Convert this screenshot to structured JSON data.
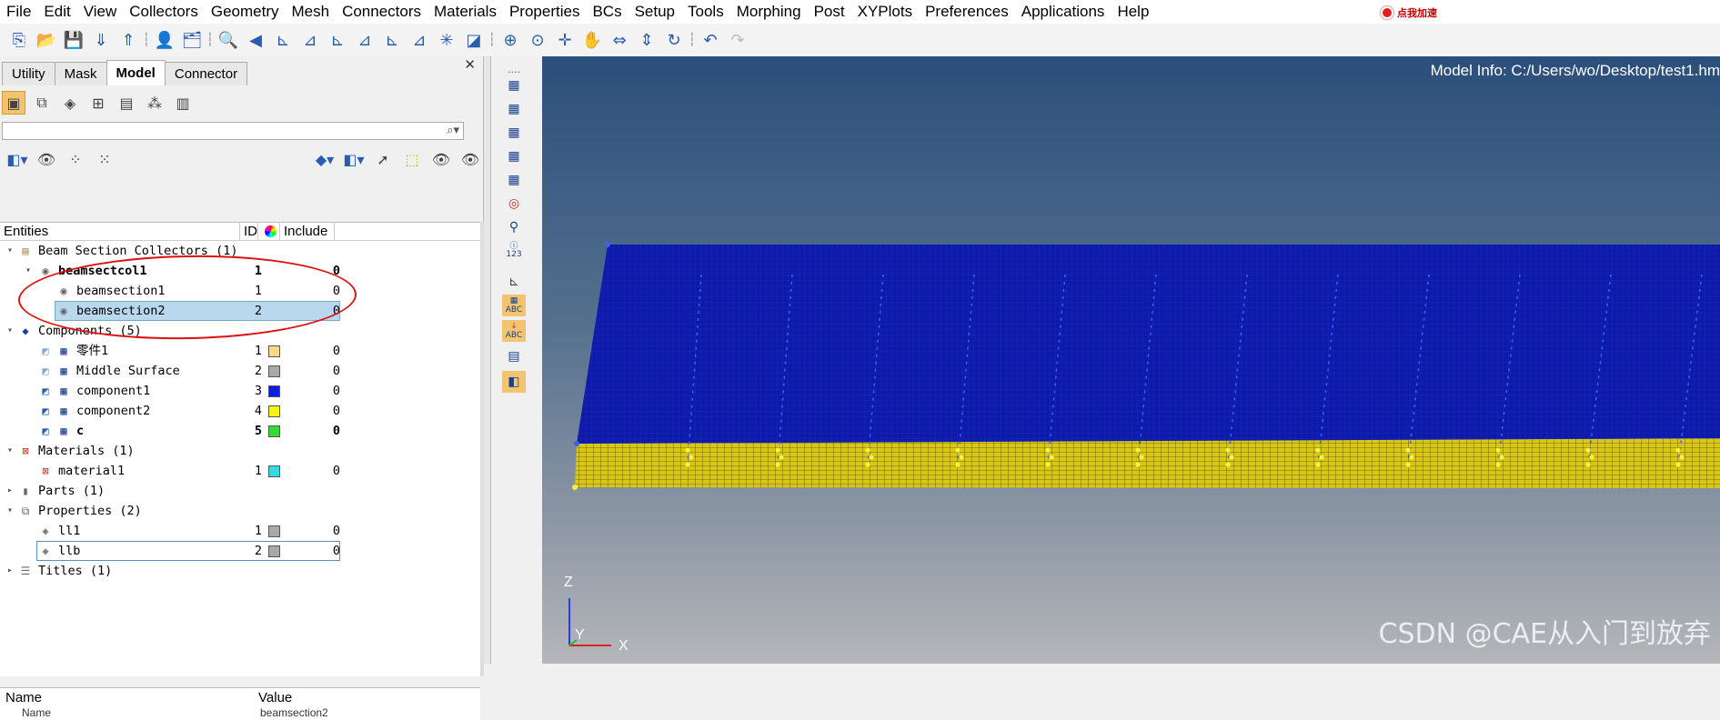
{
  "menu": [
    "File",
    "Edit",
    "View",
    "Collectors",
    "Geometry",
    "Mesh",
    "Connectors",
    "Materials",
    "Properties",
    "BCs",
    "Setup",
    "Tools",
    "Morphing",
    "Post",
    "XYPlots",
    "Preferences",
    "Applications",
    "Help"
  ],
  "accel_badge": "点我加速",
  "tabs": [
    "Utility",
    "Mask",
    "Model",
    "Connector"
  ],
  "active_tab": "Model",
  "browser": {
    "headers": {
      "entities": "Entities",
      "id": "ID",
      "include": "Include"
    },
    "rows": [
      {
        "name": "Beam Section Collectors (1)",
        "id": "",
        "include": ""
      },
      {
        "name": "beamsectcol1",
        "id": "1",
        "include": "0"
      },
      {
        "name": "beamsection1",
        "id": "1",
        "include": "0"
      },
      {
        "name": "beamsection2",
        "id": "2",
        "include": "0"
      },
      {
        "name": "Components (5)",
        "id": "",
        "include": ""
      },
      {
        "name": "零件1",
        "id": "1",
        "include": "0",
        "color": "#f6d98a"
      },
      {
        "name": "Middle Surface",
        "id": "2",
        "include": "0",
        "color": "#a8a8a8"
      },
      {
        "name": "component1",
        "id": "3",
        "include": "0",
        "color": "#1020d8"
      },
      {
        "name": "component2",
        "id": "4",
        "include": "0",
        "color": "#f4f414"
      },
      {
        "name": "c",
        "id": "5",
        "include": "0",
        "color": "#38d838"
      },
      {
        "name": "Materials (1)",
        "id": "",
        "include": ""
      },
      {
        "name": "material1",
        "id": "1",
        "include": "0",
        "color": "#38d8e0"
      },
      {
        "name": "Parts (1)",
        "id": "",
        "include": ""
      },
      {
        "name": "Properties (2)",
        "id": "",
        "include": ""
      },
      {
        "name": "ll1",
        "id": "1",
        "include": "0",
        "color": "#a8a8a8"
      },
      {
        "name": "llb",
        "id": "2",
        "include": "0",
        "color": "#a8a8a8"
      },
      {
        "name": "Titles (1)",
        "id": "",
        "include": ""
      }
    ]
  },
  "properties": {
    "name_header": "Name",
    "value_header": "Value",
    "row_name": "Name",
    "row_value": "beamsection2"
  },
  "viewport": {
    "model_info": "Model Info: C:/Users/wo/Desktop/test1.hm",
    "axis": {
      "z": "Z",
      "y": "Y",
      "x": "X"
    },
    "watermark": "CSDN @CAE从入门到放弃",
    "colors": {
      "top_plate": "#0d1aa8",
      "bottom_plate": "#d8c814",
      "nodes": "#3a60ff",
      "beam": "#f6f632"
    }
  },
  "sidebar_text": {
    "dots": "....",
    "label_123": "123",
    "label_abc1": "ABC",
    "label_abc2": "ABC"
  }
}
